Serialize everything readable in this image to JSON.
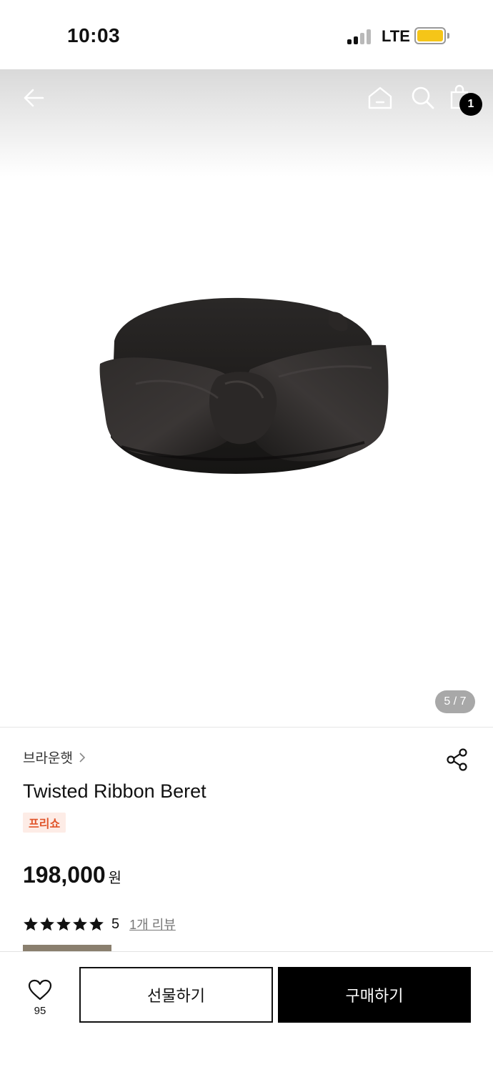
{
  "status_bar": {
    "time": "10:03",
    "network": "LTE",
    "battery_color": "#f5c518"
  },
  "top_nav": {
    "icons": [
      "back-arrow-icon",
      "home-icon",
      "search-icon",
      "shopping-bag-icon"
    ],
    "cart_count": "1"
  },
  "gallery": {
    "indicator": "5 / 7"
  },
  "product": {
    "brand": "브라운햇",
    "title": "Twisted Ribbon Beret",
    "tag": "프리쇼",
    "price": "198,000",
    "currency": "원",
    "rating_value": "5",
    "rating_stars": 5,
    "review_link": "1개 리뷰"
  },
  "bottom_bar": {
    "like_count": "95",
    "gift_label": "선물하기",
    "buy_label": "구매하기"
  },
  "colors": {
    "tag_bg": "#fdece6",
    "tag_text": "#e0552b",
    "primary": "#000000"
  }
}
